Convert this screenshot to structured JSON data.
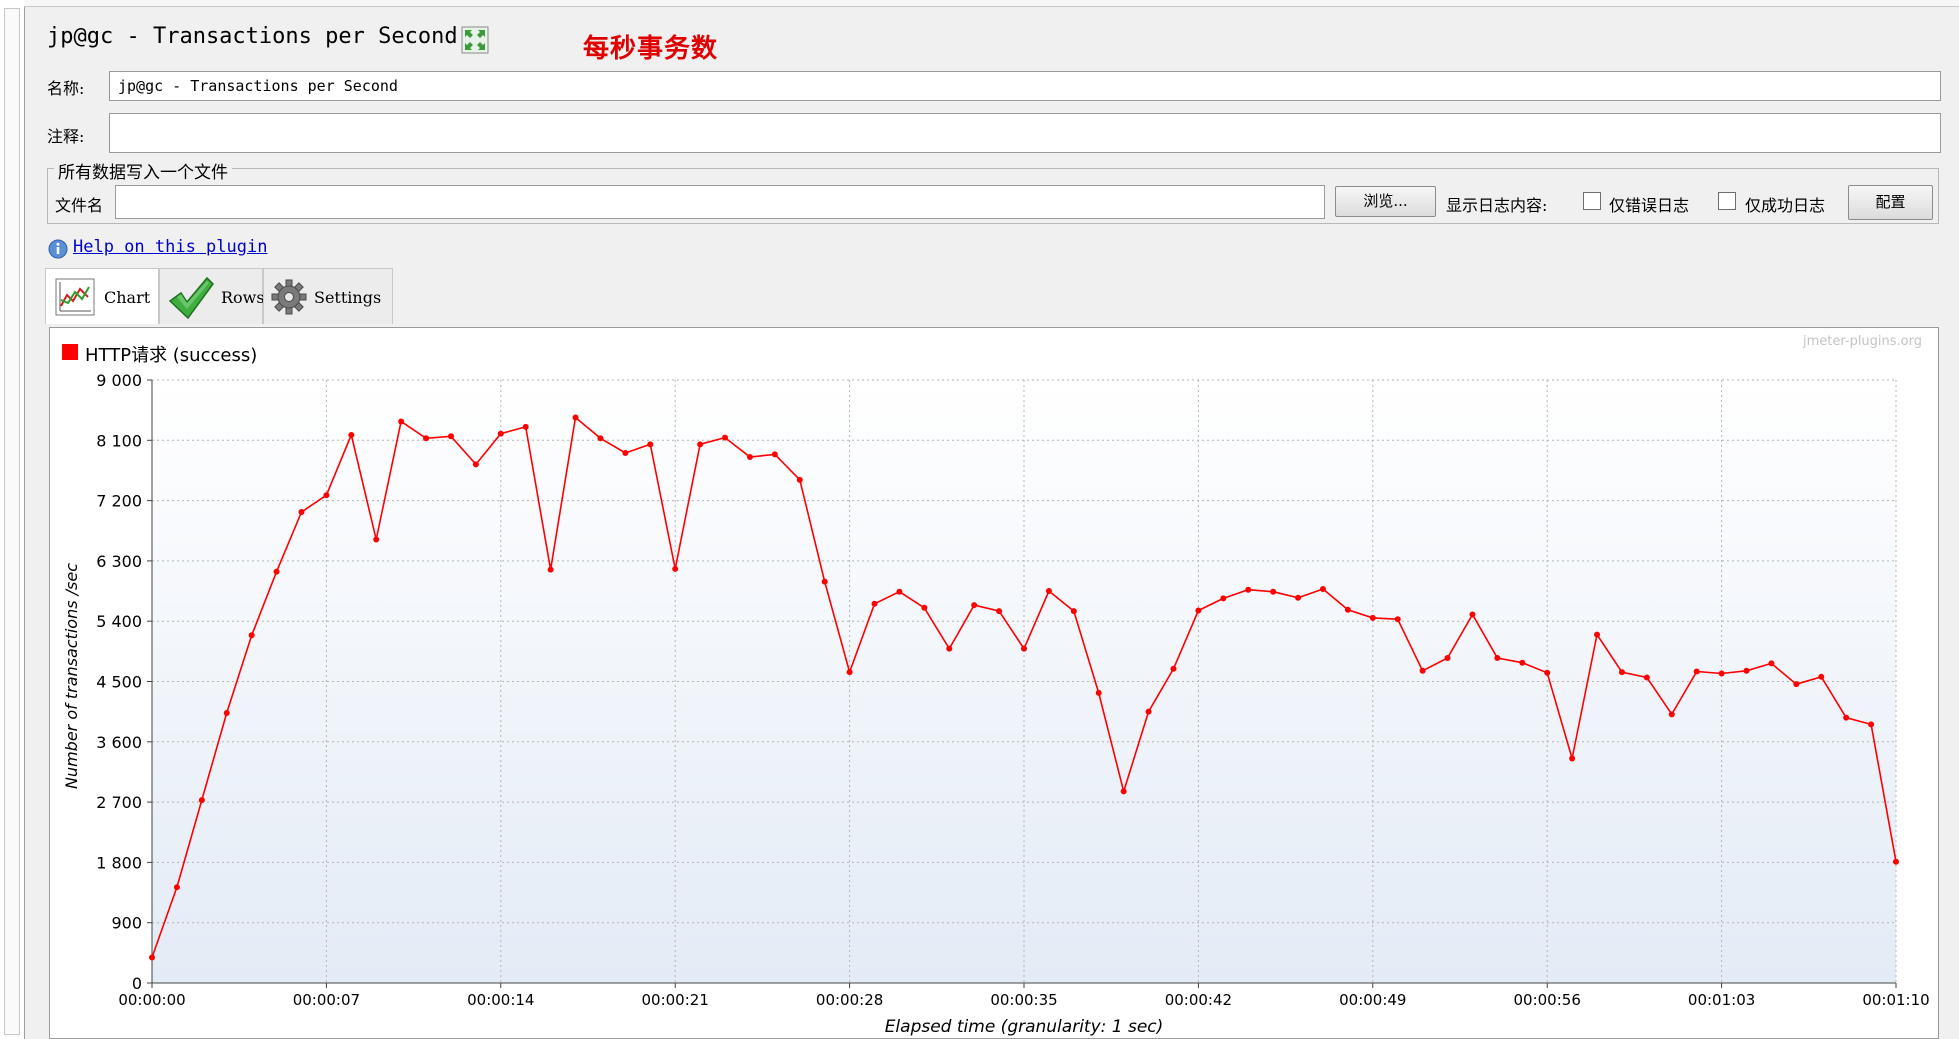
{
  "window": {
    "panel_title": "jp@gc - Transactions per Second",
    "annotation_title": "每秒事务数",
    "expand_icon": "expand-arrows-icon"
  },
  "form": {
    "name_label": "名称:",
    "name_value": "jp@gc - Transactions per Second",
    "comment_label": "注释:",
    "comment_value": ""
  },
  "file_section": {
    "legend": "所有数据写入一个文件",
    "filename_label": "文件名",
    "filename_value": "",
    "browse_label": "浏览...",
    "show_log_label": "显示日志内容:",
    "errors_only_label": "仅错误日志",
    "errors_only_checked": false,
    "success_only_label": "仅成功日志",
    "success_only_checked": false,
    "config_label": "配置"
  },
  "help": {
    "icon": "info-icon",
    "link_text": "Help on this plugin"
  },
  "tabs": [
    {
      "label": "Chart",
      "icon": "chart-icon",
      "active": true
    },
    {
      "label": "Rows",
      "icon": "checkmark-icon",
      "active": false
    },
    {
      "label": "Settings",
      "icon": "gear-icon",
      "active": false
    }
  ],
  "chart_data": {
    "type": "line",
    "watermark": "jmeter-plugins.org",
    "legend_position": "top-left",
    "grid": true,
    "xlabel": "Elapsed time (granularity: 1 sec)",
    "ylabel": "Number of transactions /sec",
    "ylim": [
      0,
      9000
    ],
    "yticks": [
      0,
      900,
      1800,
      2700,
      3600,
      4500,
      5400,
      6300,
      7200,
      8100,
      9000
    ],
    "ytick_labels": [
      "0",
      "900",
      "1 800",
      "2 700",
      "3 600",
      "4 500",
      "5 400",
      "6 300",
      "7 200",
      "8 100",
      "9 000"
    ],
    "xlim": [
      0,
      70
    ],
    "xticks": [
      0,
      7,
      14,
      21,
      28,
      35,
      42,
      49,
      56,
      63,
      70
    ],
    "xtick_labels": [
      "00:00:00",
      "00:00:07",
      "00:00:14",
      "00:00:21",
      "00:00:28",
      "00:00:35",
      "00:00:42",
      "00:00:49",
      "00:00:56",
      "00:01:03",
      "00:01:10"
    ],
    "series": [
      {
        "name": "HTTP请求 (success)",
        "color": "#ff0000",
        "x": [
          0,
          1,
          2,
          3,
          4,
          5,
          6,
          7,
          8,
          9,
          10,
          11,
          12,
          13,
          14,
          15,
          16,
          17,
          18,
          19,
          20,
          21,
          22,
          23,
          24,
          25,
          26,
          27,
          28,
          29,
          30,
          31,
          32,
          33,
          34,
          35,
          36,
          37,
          38,
          39,
          40,
          41,
          42,
          43,
          44,
          45,
          46,
          47,
          48,
          49,
          50,
          51,
          52,
          53,
          54,
          55,
          56,
          57,
          58,
          59,
          60,
          61,
          62,
          63,
          64,
          65,
          66,
          67,
          68,
          69,
          70
        ],
        "values": [
          380,
          1430,
          2730,
          4030,
          5190,
          6140,
          7030,
          7280,
          8180,
          6620,
          8380,
          8130,
          8160,
          7740,
          8200,
          8300,
          6170,
          8440,
          8130,
          7910,
          8040,
          6180,
          8040,
          8140,
          7850,
          7890,
          7510,
          5990,
          4640,
          5660,
          5840,
          5600,
          4990,
          5640,
          5550,
          4990,
          5850,
          5550,
          4330,
          2860,
          4050,
          4690,
          5560,
          5740,
          5870,
          5840,
          5750,
          5880,
          5570,
          5450,
          5430,
          4660,
          4850,
          5500,
          4850,
          4780,
          4630,
          3350,
          5200,
          4640,
          4560,
          4010,
          4650,
          4620,
          4660,
          4770,
          4460,
          4570,
          3960,
          3860,
          1810
        ]
      }
    ]
  }
}
